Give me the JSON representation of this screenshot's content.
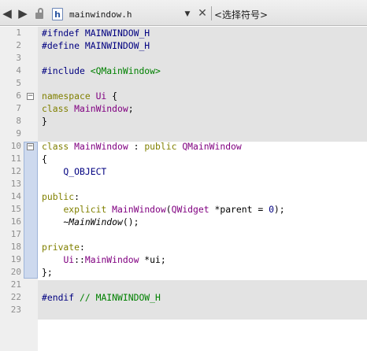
{
  "toolbar": {
    "back_icon": "◀",
    "forward_icon": "▶",
    "file_name": "mainwindow.h",
    "file_icon_letter": "h",
    "close_glyph": "✕",
    "symbol_combo": "<选择符号>"
  },
  "editor": {
    "line_numbers": [
      "1",
      "2",
      "3",
      "4",
      "5",
      "6",
      "7",
      "8",
      "9",
      "10",
      "11",
      "12",
      "13",
      "14",
      "15",
      "16",
      "17",
      "18",
      "19",
      "20",
      "21",
      "22",
      "23"
    ],
    "lines": [
      [
        {
          "t": "#ifndef MAINWINDOW_H",
          "c": "pre"
        }
      ],
      [
        {
          "t": "#define MAINWINDOW_H",
          "c": "pre"
        }
      ],
      [],
      [
        {
          "t": "#include ",
          "c": "pre"
        },
        {
          "t": "<QMainWindow>",
          "c": "str"
        }
      ],
      [],
      [
        {
          "t": "namespace ",
          "c": "kw"
        },
        {
          "t": "Ui",
          "c": "cls"
        },
        {
          "t": " {",
          "c": ""
        }
      ],
      [
        {
          "t": "class ",
          "c": "kw"
        },
        {
          "t": "MainWindow",
          "c": "cls"
        },
        {
          "t": ";",
          "c": ""
        }
      ],
      [
        {
          "t": "}",
          "c": ""
        }
      ],
      [],
      [
        {
          "t": "class ",
          "c": "kw"
        },
        {
          "t": "MainWindow",
          "c": "cls"
        },
        {
          "t": " : ",
          "c": ""
        },
        {
          "t": "public ",
          "c": "kw"
        },
        {
          "t": "QMainWindow",
          "c": "cls"
        }
      ],
      [
        {
          "t": "{",
          "c": ""
        }
      ],
      [
        {
          "t": "    Q_OBJECT",
          "c": "macro"
        }
      ],
      [],
      [
        {
          "t": "public",
          "c": "kw"
        },
        {
          "t": ":",
          "c": ""
        }
      ],
      [
        {
          "t": "    ",
          "c": ""
        },
        {
          "t": "explicit ",
          "c": "kw"
        },
        {
          "t": "MainWindow",
          "c": "cls"
        },
        {
          "t": "(",
          "c": ""
        },
        {
          "t": "QWidget",
          "c": "cls"
        },
        {
          "t": " *parent = ",
          "c": ""
        },
        {
          "t": "0",
          "c": "num"
        },
        {
          "t": ");",
          "c": ""
        }
      ],
      [
        {
          "t": "    ~",
          "c": ""
        },
        {
          "t": "MainWindow",
          "c": "it"
        },
        {
          "t": "();",
          "c": ""
        }
      ],
      [],
      [
        {
          "t": "private",
          "c": "kw"
        },
        {
          "t": ":",
          "c": ""
        }
      ],
      [
        {
          "t": "    ",
          "c": ""
        },
        {
          "t": "Ui",
          "c": "cls"
        },
        {
          "t": "::",
          "c": ""
        },
        {
          "t": "MainWindow",
          "c": "cls"
        },
        {
          "t": " *ui;",
          "c": ""
        }
      ],
      [
        {
          "t": "};",
          "c": ""
        }
      ],
      [],
      [
        {
          "t": "#endif ",
          "c": "pre"
        },
        {
          "t": "// MAINWINDOW_H",
          "c": "cmt"
        }
      ],
      []
    ]
  }
}
